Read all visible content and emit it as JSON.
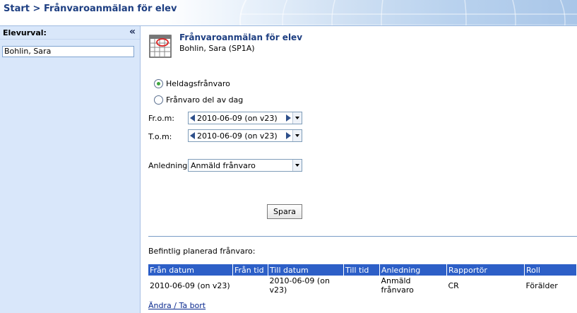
{
  "breadcrumb": {
    "start": "Start",
    "separator": ">",
    "current": "Frånvaroanmälan för elev"
  },
  "sidebar": {
    "title": "Elevurval:",
    "collapse_glyph": "«",
    "selected_student": "Bohlin, Sara"
  },
  "form": {
    "title": "Frånvaroanmälan för elev",
    "student": "Bohlin, Sara  (SP1A)",
    "radio_fullday": "Heldagsfrånvaro",
    "radio_partday": "Frånvaro del av dag",
    "from_label": "Fr.o.m:",
    "from_value": "2010-06-09 (on v23)",
    "to_label": "T.o.m:",
    "to_value": "2010-06-09 (on v23)",
    "reason_label": "Anledning:",
    "reason_value": "Anmäld frånvaro",
    "save_label": "Spara"
  },
  "existing": {
    "heading": "Befintlig planerad frånvaro:",
    "columns": [
      "Från datum",
      "Från tid",
      "Till datum",
      "Till tid",
      "Anledning",
      "Rapportör",
      "Roll"
    ],
    "rows": [
      [
        "2010-06-09 (on v23)",
        "",
        "2010-06-09 (on v23)",
        "",
        "Anmäld frånvaro",
        "CR",
        "Förälder"
      ]
    ],
    "edit_link": "Ändra / Ta bort"
  },
  "icons": {
    "collapse": "double-chevron-left-icon",
    "calendar": "calendar-icon",
    "prev": "arrow-left-icon",
    "next": "arrow-right-icon",
    "dropdown": "dropdown-arrow-icon"
  },
  "colors": {
    "header_text": "#1e3f82",
    "sidebar_bg": "#d9e7fa",
    "table_header": "#2d5fc7"
  }
}
